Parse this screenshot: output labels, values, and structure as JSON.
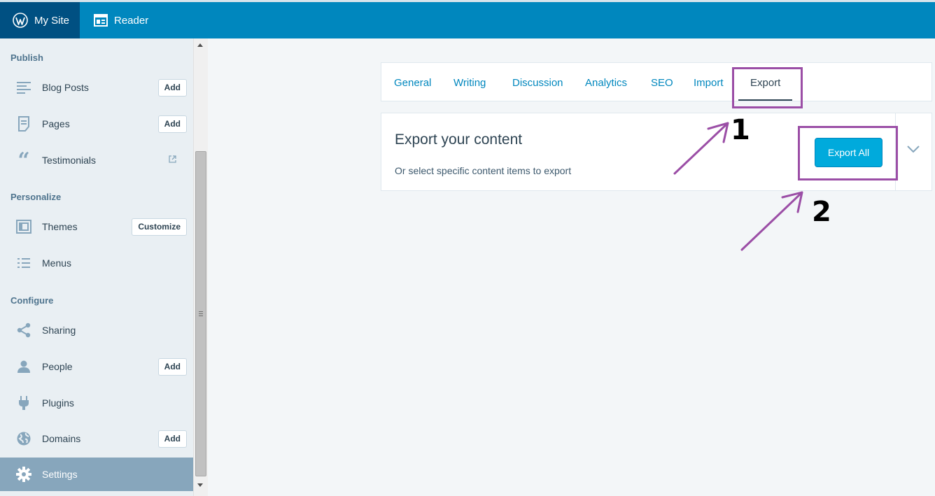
{
  "topbar": {
    "my_site": "My Site",
    "reader": "Reader"
  },
  "sidebar": {
    "sections": [
      {
        "label": "Publish"
      },
      {
        "label": "Personalize"
      },
      {
        "label": "Configure"
      }
    ],
    "items": {
      "blog_posts": {
        "label": "Blog Posts",
        "action": "Add",
        "icon": "posts-icon"
      },
      "pages": {
        "label": "Pages",
        "action": "Add",
        "icon": "pages-icon"
      },
      "testimonials": {
        "label": "Testimonials",
        "icon": "quote-icon"
      },
      "themes": {
        "label": "Themes",
        "action": "Customize",
        "icon": "themes-icon"
      },
      "menus": {
        "label": "Menus",
        "icon": "menus-icon"
      },
      "sharing": {
        "label": "Sharing",
        "icon": "share-icon"
      },
      "people": {
        "label": "People",
        "action": "Add",
        "icon": "person-icon"
      },
      "plugins": {
        "label": "Plugins",
        "icon": "plug-icon"
      },
      "domains": {
        "label": "Domains",
        "action": "Add",
        "icon": "globe-icon"
      },
      "settings": {
        "label": "Settings",
        "icon": "gear-icon"
      }
    }
  },
  "settings_nav": {
    "tabs": [
      "General",
      "Writing",
      "Discussion",
      "Analytics",
      "SEO",
      "Import",
      "Export"
    ],
    "selected": "Export"
  },
  "export_card": {
    "title": "Export your content",
    "subtitle": "Or select specific content items to export",
    "button": "Export All"
  },
  "annotations": {
    "step1": "1",
    "step2": "2",
    "color": "#9b4ea6"
  },
  "colors": {
    "topbar": "#0087be",
    "topbar_active": "#005082",
    "accent_button": "#00aadc",
    "sidebar_active": "#87a6bc"
  }
}
